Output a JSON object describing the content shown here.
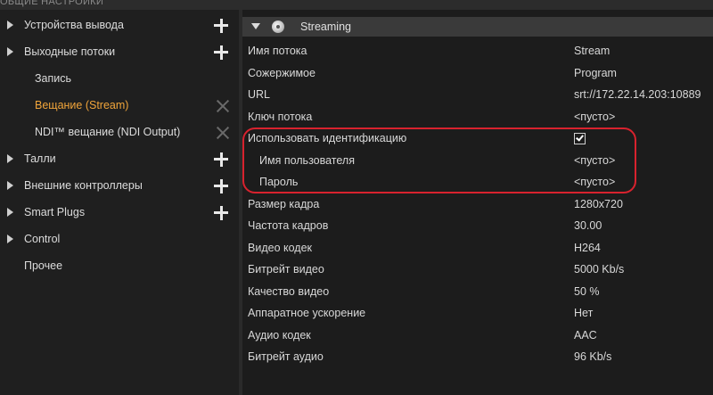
{
  "window": {
    "title": "ОБЩИЕ НАСТРОЙКИ"
  },
  "sidebar": {
    "items": [
      {
        "label": "Устройства вывода",
        "expandable": true,
        "action": "add"
      },
      {
        "label": "Выходные потоки",
        "expandable": true,
        "action": "add"
      },
      {
        "label": "Запись",
        "expandable": false,
        "action": "none"
      },
      {
        "label": "Вещание (Stream)",
        "expandable": false,
        "action": "remove",
        "active": true
      },
      {
        "label": "NDI™ вещание (NDI Output)",
        "expandable": false,
        "action": "remove"
      },
      {
        "label": "Талли",
        "expandable": true,
        "action": "add"
      },
      {
        "label": "Внешние контроллеры",
        "expandable": true,
        "action": "add"
      },
      {
        "label": "Smart Plugs",
        "expandable": true,
        "action": "add"
      },
      {
        "label": "Control",
        "expandable": true,
        "action": "none"
      },
      {
        "label": "Прочее",
        "expandable": false,
        "action": "none"
      }
    ]
  },
  "panel": {
    "title": "Streaming",
    "properties": [
      {
        "name": "Имя потока",
        "value": "Stream"
      },
      {
        "name": "Сожержимое",
        "value": "Program"
      },
      {
        "name": "URL",
        "value": "srt://172.22.14.203:10889"
      },
      {
        "name": "Ключ потока",
        "value": "<пусто>"
      },
      {
        "name": "Использовать идентификацию",
        "value": "",
        "checked": true
      },
      {
        "name": "Имя пользователя",
        "value": "<пусто>",
        "indent": true
      },
      {
        "name": "Пароль",
        "value": "<пусто>",
        "indent": true
      },
      {
        "name": "Размер кадра",
        "value": "1280x720"
      },
      {
        "name": "Частота кадров",
        "value": "30.00"
      },
      {
        "name": "Видео кодек",
        "value": "H264"
      },
      {
        "name": "Битрейт видео",
        "value": "5000 Kb/s"
      },
      {
        "name": "Качество видео",
        "value": "50 %"
      },
      {
        "name": "Аппаратное ускорение",
        "value": "Нет"
      },
      {
        "name": "Аудио кодек",
        "value": "AAC"
      },
      {
        "name": "Битрейт аудио",
        "value": "96 Kb/s"
      }
    ]
  },
  "colors": {
    "active_item": "#f0a43a",
    "highlight_frame": "#d8222e",
    "panel_background": "#1c1c1c"
  }
}
